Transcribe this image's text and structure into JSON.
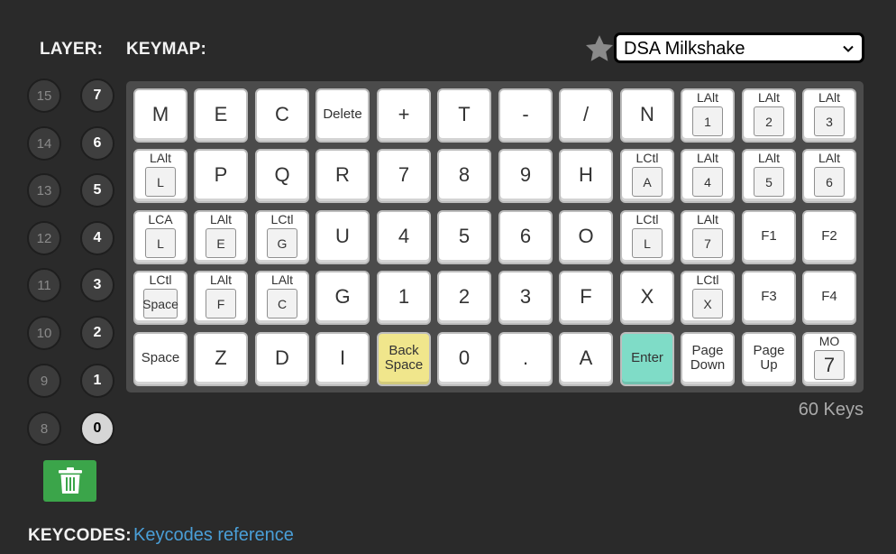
{
  "headings": {
    "layer": "LAYER:",
    "keymap": "KEYMAP:",
    "keycodes": "KEYCODES:"
  },
  "keycodes_link": "Keycodes reference",
  "keymap_select": {
    "value": "DSA Milkshake"
  },
  "key_count": "60 Keys",
  "layers": {
    "inactive": [
      "15",
      "14",
      "13",
      "12",
      "11",
      "10",
      "9",
      "8"
    ],
    "active": [
      "7",
      "6",
      "5",
      "4",
      "3",
      "2",
      "1",
      "0"
    ],
    "selected": "0"
  },
  "colors": {
    "backspace_key": "#f0e68c",
    "enter_key": "#7fdcc7",
    "trash_button": "#3ba54a",
    "link": "#4a9fd8"
  },
  "icons": {
    "star": "star-icon",
    "trash": "trash-icon",
    "dropdown": "chevron-down-icon"
  },
  "keys": [
    [
      {
        "label": "M"
      },
      {
        "label": "E"
      },
      {
        "label": "C"
      },
      {
        "label": "Delete",
        "size": "small"
      },
      {
        "label": "+"
      },
      {
        "label": "T"
      },
      {
        "label": "-"
      },
      {
        "label": "/"
      },
      {
        "label": "N"
      },
      {
        "mod": "LAlt",
        "label": "1"
      },
      {
        "mod": "LAlt",
        "label": "2"
      },
      {
        "mod": "LAlt",
        "label": "3"
      }
    ],
    [
      {
        "mod": "LAlt",
        "label": "L"
      },
      {
        "label": "P"
      },
      {
        "label": "Q"
      },
      {
        "label": "R"
      },
      {
        "label": "7"
      },
      {
        "label": "8"
      },
      {
        "label": "9"
      },
      {
        "label": "H"
      },
      {
        "mod": "LCtl",
        "label": "A"
      },
      {
        "mod": "LAlt",
        "label": "4"
      },
      {
        "mod": "LAlt",
        "label": "5"
      },
      {
        "mod": "LAlt",
        "label": "6"
      }
    ],
    [
      {
        "mod": "LCA",
        "label": "L"
      },
      {
        "mod": "LAlt",
        "label": "E"
      },
      {
        "mod": "LCtl",
        "label": "G"
      },
      {
        "label": "U"
      },
      {
        "label": "4"
      },
      {
        "label": "5"
      },
      {
        "label": "6"
      },
      {
        "label": "O"
      },
      {
        "mod": "LCtl",
        "label": "L"
      },
      {
        "mod": "LAlt",
        "label": "7"
      },
      {
        "label": "F1",
        "size": "small"
      },
      {
        "label": "F2",
        "size": "small"
      }
    ],
    [
      {
        "mod": "LCtl",
        "label": "Space"
      },
      {
        "mod": "LAlt",
        "label": "F"
      },
      {
        "mod": "LAlt",
        "label": "C"
      },
      {
        "label": "G"
      },
      {
        "label": "1"
      },
      {
        "label": "2"
      },
      {
        "label": "3"
      },
      {
        "label": "F"
      },
      {
        "label": "X"
      },
      {
        "mod": "LCtl",
        "label": "X"
      },
      {
        "label": "F3",
        "size": "small"
      },
      {
        "label": "F4",
        "size": "small"
      }
    ],
    [
      {
        "label": "Space",
        "size": "small"
      },
      {
        "label": "Z"
      },
      {
        "label": "D"
      },
      {
        "label": "I"
      },
      {
        "label": "Back\nSpace",
        "size": "small",
        "color": "backspace_key"
      },
      {
        "label": "0"
      },
      {
        "label": "."
      },
      {
        "label": "A"
      },
      {
        "label": "Enter",
        "size": "small",
        "color": "enter_key"
      },
      {
        "label": "Page\nDown",
        "size": "small"
      },
      {
        "label": "Page\nUp",
        "size": "small"
      },
      {
        "mod": "MO",
        "label": "7",
        "inner": "big"
      }
    ]
  ]
}
